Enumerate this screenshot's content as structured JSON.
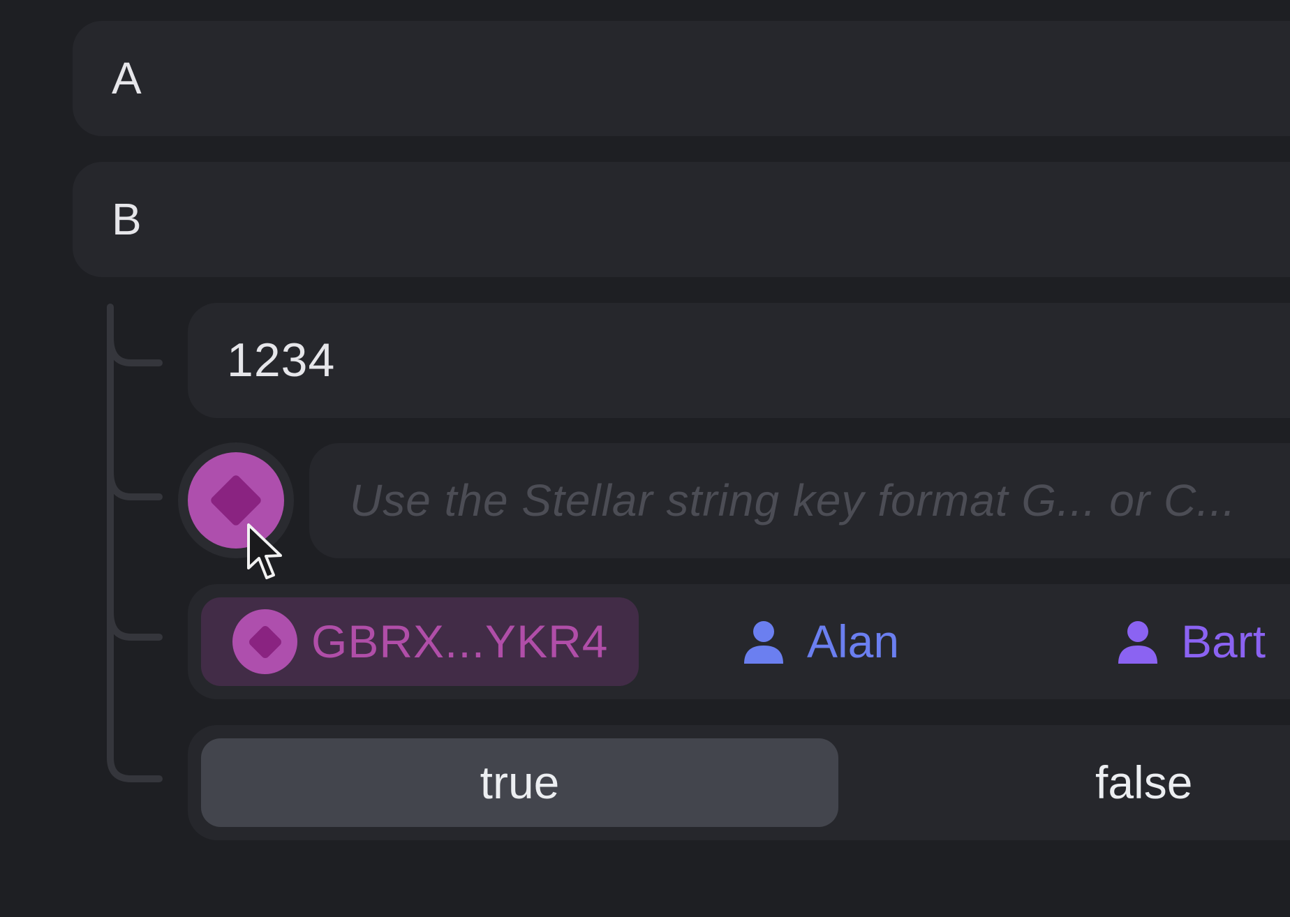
{
  "fields": {
    "a_label": "A",
    "b_label": "B",
    "number_value": "1234",
    "address_placeholder": "Use the Stellar string key format G... or C..."
  },
  "recipient": {
    "selected_label": "GBRX...YKR4",
    "options": [
      {
        "label": "Alan",
        "color": "#6b7ff0"
      },
      {
        "label": "Bart",
        "color": "#8b63f2"
      }
    ]
  },
  "bool": {
    "true_label": "true",
    "false_label": "false",
    "selected": "true"
  },
  "colors": {
    "background": "#1e1f23",
    "field": "#26272c",
    "stellar_accent": "#ae4fad",
    "selected_chip": "#422c47",
    "bool_selected": "#43454d"
  },
  "icons": {
    "stellar": "diamond-icon",
    "contact": "person-icon",
    "pointer": "cursor-arrow-icon"
  }
}
